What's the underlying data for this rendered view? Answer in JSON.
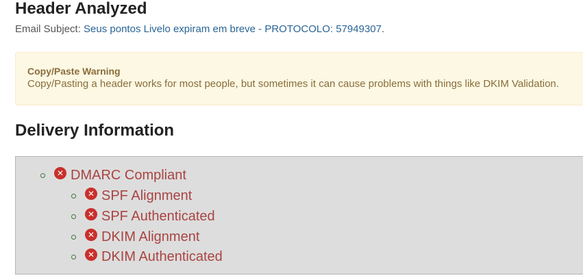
{
  "header": {
    "title": "Header Analyzed",
    "subject_label": "Email Subject:",
    "subject_value": "Seus pontos Livelo expiram em breve - PROTOCOLO: 57949307",
    "subject_end": "."
  },
  "warning": {
    "title": "Copy/Paste Warning",
    "text": "Copy/Pasting a header works for most people, but sometimes it can cause problems with things like DKIM Validation."
  },
  "delivery": {
    "title": "Delivery Information",
    "dmarc": {
      "label": "DMARC Compliant",
      "status": "fail",
      "icon": "x-circle-icon"
    },
    "checks": [
      {
        "label": "SPF Alignment",
        "status": "fail",
        "icon": "x-circle-icon"
      },
      {
        "label": "SPF Authenticated",
        "status": "fail",
        "icon": "x-circle-icon"
      },
      {
        "label": "DKIM Alignment",
        "status": "fail",
        "icon": "x-circle-icon"
      },
      {
        "label": "DKIM Authenticated",
        "status": "fail",
        "icon": "x-circle-icon"
      }
    ]
  },
  "colors": {
    "fail": "#c9302c",
    "fail_text": "#a94442",
    "link": "#2a6496",
    "warning_bg": "#fcf8e3",
    "warning_text": "#8a6d3b",
    "panel_bg": "#dddddd"
  }
}
